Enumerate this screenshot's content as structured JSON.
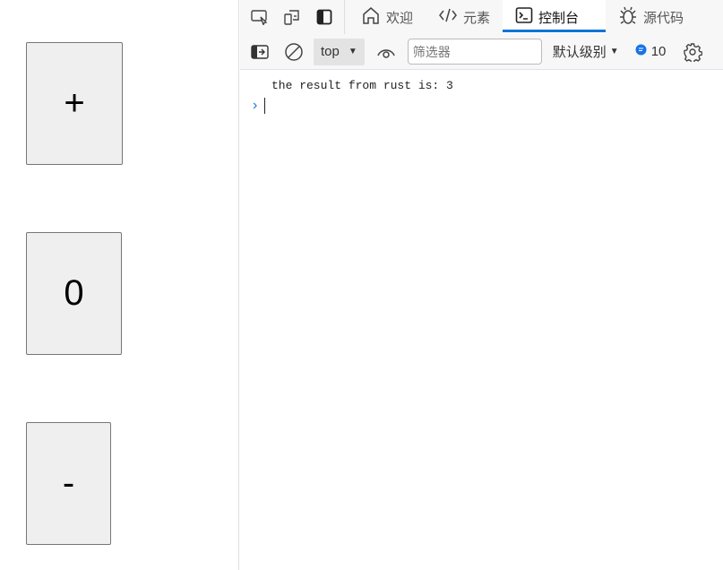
{
  "page": {
    "plus_label": "+",
    "count_value": "0",
    "minus_label": "-"
  },
  "devtools": {
    "tabs": [
      {
        "label": "欢迎",
        "icon": "home-icon"
      },
      {
        "label": "元素",
        "icon": "code-icon"
      },
      {
        "label": "控制台",
        "icon": "console-icon"
      },
      {
        "label": "源代码",
        "icon": "bug-icon"
      }
    ],
    "context": "top",
    "filter_placeholder": "筛选器",
    "level": "默认级别",
    "message_count": "10",
    "accent": "#0a74d6"
  },
  "console": {
    "lines": [
      "the result from rust is: 3"
    ]
  }
}
